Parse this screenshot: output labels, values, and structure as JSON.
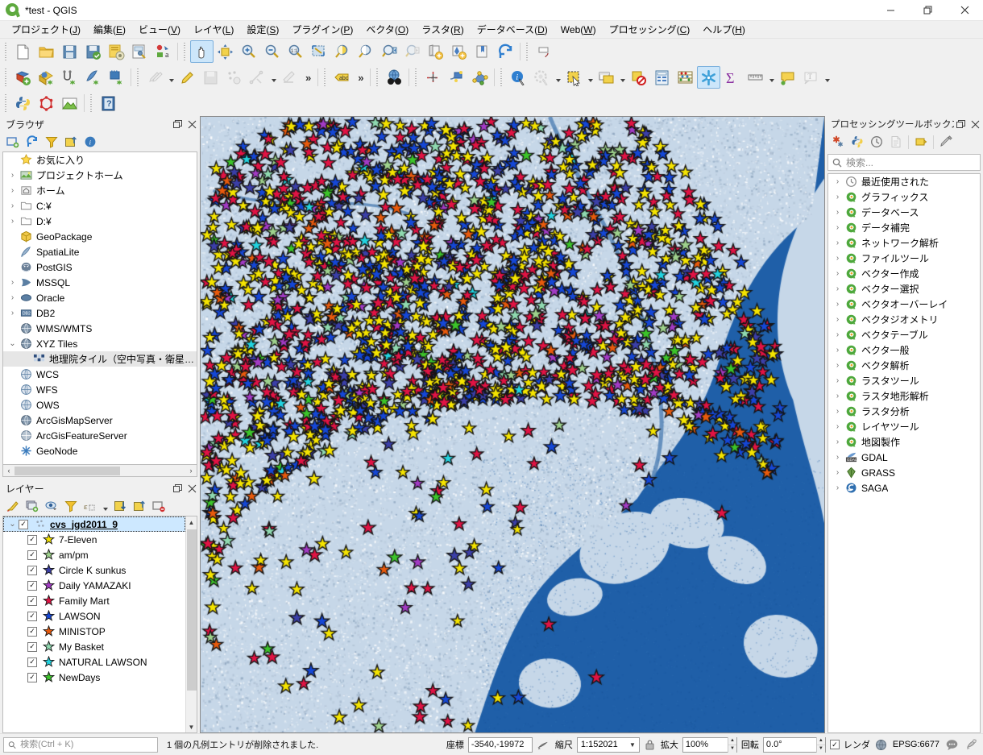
{
  "window": {
    "title": "*test - QGIS",
    "app_icon": "qgis-logo-icon",
    "minimize": "–",
    "maximize": "❐",
    "close": "✕"
  },
  "menubar": {
    "items": [
      {
        "label": "プロジェクト(J)",
        "name": "menu-project"
      },
      {
        "label": "編集(E)",
        "name": "menu-edit"
      },
      {
        "label": "ビュー(V)",
        "name": "menu-view"
      },
      {
        "label": "レイヤ(L)",
        "name": "menu-layer"
      },
      {
        "label": "設定(S)",
        "name": "menu-settings"
      },
      {
        "label": "プラグイン(P)",
        "name": "menu-plugins"
      },
      {
        "label": "ベクタ(O)",
        "name": "menu-vector"
      },
      {
        "label": "ラスタ(R)",
        "name": "menu-raster"
      },
      {
        "label": "データベース(D)",
        "name": "menu-database"
      },
      {
        "label": "Web(W)",
        "name": "menu-web"
      },
      {
        "label": "プロセッシング(C)",
        "name": "menu-processing"
      },
      {
        "label": "ヘルプ(H)",
        "name": "menu-help"
      }
    ]
  },
  "toolbar": {
    "row1": [
      "new-project-icon",
      "open-project-icon",
      "save-project-icon",
      "save-project-as-icon",
      "new-print-layout-icon",
      "layout-manager-icon",
      "style-manager-icon",
      "pan-map-icon",
      "pan-to-selection-icon",
      "zoom-in-icon",
      "zoom-out-icon",
      "zoom-native-icon",
      "zoom-full-icon",
      "zoom-to-selection-icon",
      "zoom-to-layer-icon",
      "zoom-last-icon",
      "zoom-next-icon",
      "new-map-view-icon",
      "new-3d-map-view-icon",
      "new-bookmark-icon",
      "refresh-icon",
      "dock-toggle-icon"
    ],
    "row2": [
      "add-vector-layer-icon",
      "add-raster-layer-icon",
      "add-mesh-layer-icon",
      "add-delimited-text-icon",
      "add-postgis-layer-icon",
      "current-edits-icon",
      "toggle-editing-icon",
      "save-layer-edits-icon",
      "add-feature-icon",
      "vertex-tool-icon",
      "multi-edit-icon",
      "overflow-chevron-1",
      "label-icon",
      "overflow-chevron-2",
      "osm-place-search-icon",
      "deselect-icon",
      "identify-by-value-icon",
      "select-by-expression-icon",
      "identify-features-icon",
      "run-feature-action-icon",
      "select-features-icon",
      "open-attribute-table-icon",
      "deselect-all-icon",
      "open-field-calculator-icon",
      "statistical-summary-icon",
      "processing-toolbox-icon",
      "sum-icon",
      "measure-line-icon",
      "map-tips-icon",
      "text-annotation-icon"
    ],
    "row3": [
      "python-console-icon",
      "plugin-shape-icon",
      "plugin-profile-icon",
      "help-contents-icon"
    ]
  },
  "browser_panel": {
    "title": "ブラウザ",
    "float_btn": "❏",
    "close_btn": "✕",
    "toolbar": [
      "add-layer-icon",
      "refresh-icon",
      "filter-browser-icon",
      "collapse-all-icon",
      "properties-icon"
    ],
    "items": [
      {
        "label": "お気に入り",
        "icon": "star-icon",
        "expander": "",
        "indent": 0
      },
      {
        "label": "プロジェクトホーム",
        "icon": "project-home-icon",
        "expander": "›",
        "indent": 0
      },
      {
        "label": "ホーム",
        "icon": "home-icon",
        "expander": "›",
        "indent": 0
      },
      {
        "label": "C:¥",
        "icon": "folder-icon",
        "expander": "›",
        "indent": 0
      },
      {
        "label": "D:¥",
        "icon": "folder-icon",
        "expander": "›",
        "indent": 0
      },
      {
        "label": "GeoPackage",
        "icon": "geopackage-icon",
        "expander": "",
        "indent": 0
      },
      {
        "label": "SpatiaLite",
        "icon": "spatialite-icon",
        "expander": "",
        "indent": 0
      },
      {
        "label": "PostGIS",
        "icon": "postgis-icon",
        "expander": "",
        "indent": 0
      },
      {
        "label": "MSSQL",
        "icon": "mssql-icon",
        "expander": "›",
        "indent": 0
      },
      {
        "label": "Oracle",
        "icon": "oracle-icon",
        "expander": "›",
        "indent": 0
      },
      {
        "label": "DB2",
        "icon": "db2-icon",
        "expander": "›",
        "indent": 0
      },
      {
        "label": "WMS/WMTS",
        "icon": "wms-icon",
        "expander": "",
        "indent": 0
      },
      {
        "label": "XYZ Tiles",
        "icon": "xyz-icon",
        "expander": "⌄",
        "indent": 0
      },
      {
        "label": "地理院タイル（空中写真・衛星画像）",
        "icon": "xyz-tile-icon",
        "expander": "",
        "indent": 1,
        "selected": true
      },
      {
        "label": "WCS",
        "icon": "wcs-icon",
        "expander": "",
        "indent": 0
      },
      {
        "label": "WFS",
        "icon": "wfs-icon",
        "expander": "",
        "indent": 0
      },
      {
        "label": "OWS",
        "icon": "ows-icon",
        "expander": "",
        "indent": 0
      },
      {
        "label": "ArcGisMapServer",
        "icon": "arcgis-map-icon",
        "expander": "",
        "indent": 0
      },
      {
        "label": "ArcGisFeatureServer",
        "icon": "arcgis-feature-icon",
        "expander": "",
        "indent": 0
      },
      {
        "label": "GeoNode",
        "icon": "geonode-icon",
        "expander": "",
        "indent": 0
      }
    ]
  },
  "layers_panel": {
    "title": "レイヤー",
    "float_btn": "❏",
    "close_btn": "✕",
    "toolbar": [
      "open-layer-styling-icon",
      "add-group-icon",
      "manage-visibility-icon",
      "filter-legend-icon",
      "filter-legend-expression-icon",
      "expand-all-icon",
      "collapse-all-icon",
      "remove-layer-icon"
    ],
    "group": {
      "label": "cvs_jgd2011_9",
      "checked": true,
      "expander": "⌄",
      "icon": "point-layer-icon",
      "selected": true
    },
    "items": [
      {
        "label": "7-Eleven",
        "color": "#f5e400",
        "checked": true
      },
      {
        "label": "am/pm",
        "color": "#9ed18c",
        "checked": true
      },
      {
        "label": "Circle K sunkus",
        "color": "#3b3fa8",
        "checked": true
      },
      {
        "label": "Daily YAMAZAKI",
        "color": "#a23bc4",
        "checked": true
      },
      {
        "label": "Family Mart",
        "color": "#e11344",
        "checked": true
      },
      {
        "label": "LAWSON",
        "color": "#1547d6",
        "checked": true
      },
      {
        "label": "MINISTOP",
        "color": "#e85a0d",
        "checked": true
      },
      {
        "label": "My Basket",
        "color": "#8fd9b0",
        "checked": true
      },
      {
        "label": "NATURAL LAWSON",
        "color": "#22d3e0",
        "checked": true
      },
      {
        "label": "NewDays",
        "color": "#3cc42a",
        "checked": true
      }
    ]
  },
  "processing_panel": {
    "title": "プロセッシングツールボックス",
    "float_btn": "❏",
    "close_btn": "✕",
    "toolbar": [
      "processing-options-icon",
      "python-scripts-icon",
      "history-icon",
      "results-viewer-icon",
      "models-icon",
      "edit-features-in-place-icon"
    ],
    "search_placeholder": "検索...",
    "search_value": "",
    "items": [
      {
        "label": "最近使用された",
        "icon": "clock-icon"
      },
      {
        "label": "グラフィックス",
        "icon": "qgis-provider-icon"
      },
      {
        "label": "データベース",
        "icon": "qgis-provider-icon"
      },
      {
        "label": "データ補完",
        "icon": "qgis-provider-icon"
      },
      {
        "label": "ネットワーク解析",
        "icon": "qgis-provider-icon"
      },
      {
        "label": "ファイルツール",
        "icon": "qgis-provider-icon"
      },
      {
        "label": "ベクター作成",
        "icon": "qgis-provider-icon"
      },
      {
        "label": "ベクター選択",
        "icon": "qgis-provider-icon"
      },
      {
        "label": "ベクタオーバーレイ",
        "icon": "qgis-provider-icon"
      },
      {
        "label": "ベクタジオメトリ",
        "icon": "qgis-provider-icon"
      },
      {
        "label": "ベクタテーブル",
        "icon": "qgis-provider-icon"
      },
      {
        "label": "ベクタ一般",
        "icon": "qgis-provider-icon"
      },
      {
        "label": "ベクタ解析",
        "icon": "qgis-provider-icon"
      },
      {
        "label": "ラスタツール",
        "icon": "qgis-provider-icon"
      },
      {
        "label": "ラスタ地形解析",
        "icon": "qgis-provider-icon"
      },
      {
        "label": "ラスタ分析",
        "icon": "qgis-provider-icon"
      },
      {
        "label": "レイヤツール",
        "icon": "qgis-provider-icon"
      },
      {
        "label": "地図製作",
        "icon": "qgis-provider-icon"
      },
      {
        "label": "GDAL",
        "icon": "gdal-icon"
      },
      {
        "label": "GRASS",
        "icon": "grass-icon"
      },
      {
        "label": "SAGA",
        "icon": "saga-icon"
      }
    ]
  },
  "statusbar": {
    "search_placeholder": "検索(Ctrl + K)",
    "search_value": "",
    "message": "1 個の凡例エントリが削除されました.",
    "coordinate_label": "座標",
    "coordinate_value": "-3540,-19972",
    "scale_label": "縮尺",
    "scale_value": "1:152021",
    "magnifier_label": "拡大",
    "magnifier_value": "100%",
    "rotation_label": "回転",
    "rotation_value": "0.0°",
    "render_label": "レンダ",
    "render_checked": true,
    "crs_label": "EPSG:6677",
    "lock_icon": "lock-icon",
    "extents_icon": "extents-icon",
    "crs_icon": "globe-icon",
    "messages_icon": "message-log-icon",
    "plugin_icon": "plugin-status-icon"
  },
  "map": {
    "basemap": "地理院タイル（空中写真・衛星画像）",
    "water_color": "#1f5fa8",
    "land_color": "#c6d7e8",
    "marker_colors": {
      "7-Eleven": "#f5e400",
      "am/pm": "#9ed18c",
      "Circle K sunkus": "#3b3fa8",
      "Daily YAMAZAKI": "#a23bc4",
      "Family Mart": "#e11344",
      "LAWSON": "#1547d6",
      "MINISTOP": "#e85a0d",
      "My Basket": "#8fd9b0",
      "NATURAL LAWSON": "#22d3e0",
      "NewDays": "#3cc42a"
    }
  }
}
